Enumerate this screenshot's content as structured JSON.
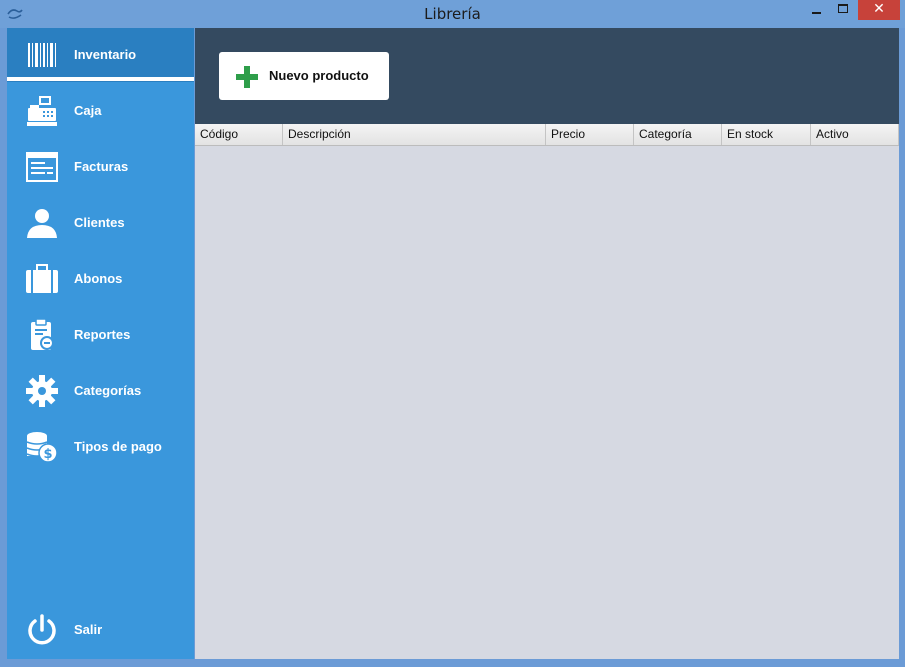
{
  "window": {
    "title": "Librería"
  },
  "sidebar": {
    "items": [
      {
        "label": "Inventario",
        "icon": "barcode-icon",
        "active": true
      },
      {
        "label": "Caja",
        "icon": "cash-register-icon"
      },
      {
        "label": "Facturas",
        "icon": "invoice-icon"
      },
      {
        "label": "Clientes",
        "icon": "user-icon"
      },
      {
        "label": "Abonos",
        "icon": "briefcase-icon"
      },
      {
        "label": "Reportes",
        "icon": "clipboard-report-icon"
      },
      {
        "label": "Categorías",
        "icon": "gear-icon"
      },
      {
        "label": "Tipos de pago",
        "icon": "coins-dollar-icon"
      }
    ],
    "exit": {
      "label": "Salir",
      "icon": "power-icon"
    }
  },
  "toolbar": {
    "new_product_label": "Nuevo producto"
  },
  "table": {
    "columns": [
      "Código",
      "Descripción",
      "Precio",
      "Categoría",
      "En stock",
      "Activo"
    ],
    "rows": []
  },
  "colors": {
    "sidebar": "#3a97dc",
    "sidebar_active": "#2a7fc1",
    "toolbar": "#344a60",
    "content": "#d6d9e2",
    "accent_plus": "#2e9e4a",
    "close_button": "#c7423a"
  }
}
